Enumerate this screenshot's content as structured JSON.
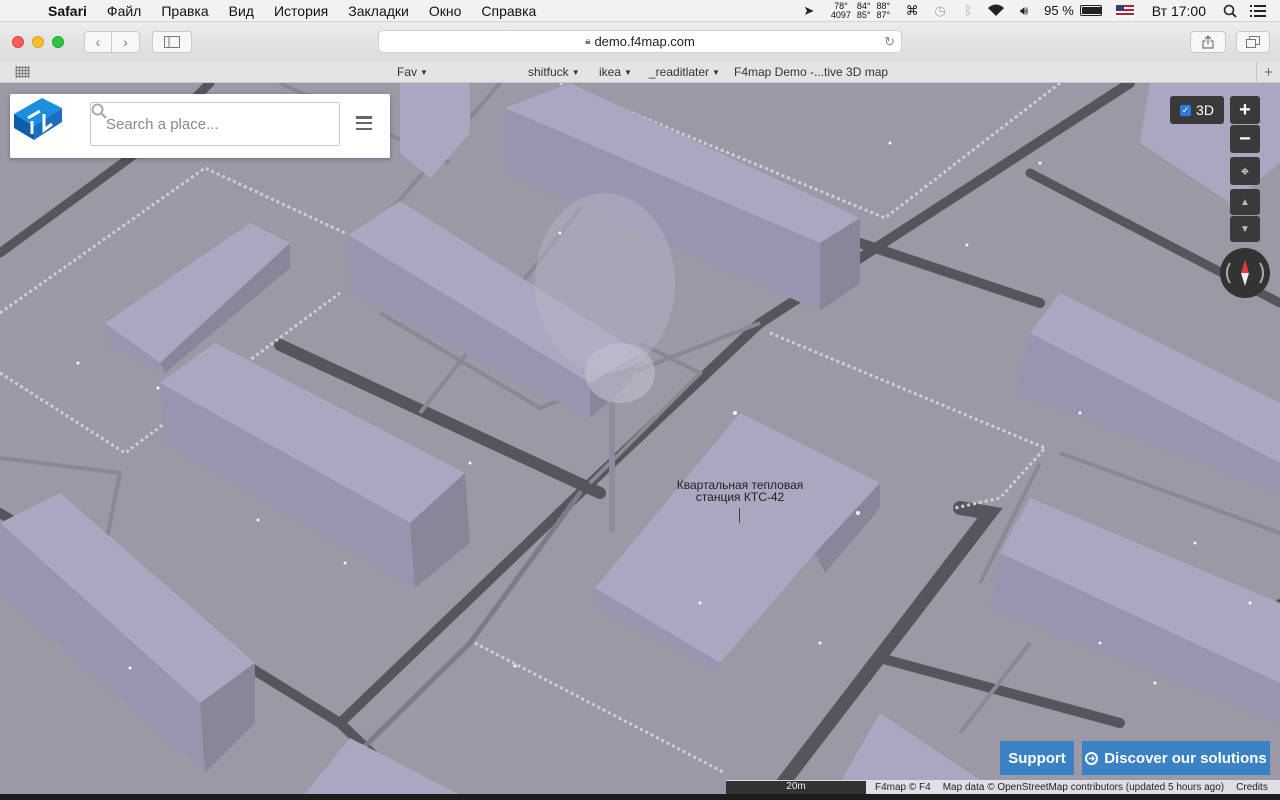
{
  "menubar": {
    "app_name": "Safari",
    "items": [
      "Файл",
      "Правка",
      "Вид",
      "История",
      "Закладки",
      "Окно",
      "Справка"
    ],
    "temps": [
      {
        "top": "78°",
        "bottom": "4097"
      },
      {
        "top": "84°",
        "bottom": "85°"
      },
      {
        "top": "88°",
        "bottom": "87°"
      }
    ],
    "battery": "95 %",
    "clock": "Вт 17:00"
  },
  "toolbar": {
    "url": "demo.f4map.com"
  },
  "bookmarks": {
    "items": [
      {
        "label": "Fav",
        "folder": true
      },
      {
        "label": "shitfuck",
        "folder": true
      },
      {
        "label": "ikea",
        "folder": true
      },
      {
        "label": "_readitlater",
        "folder": true
      },
      {
        "label": "F4map Demo -...tive 3D map",
        "folder": false
      }
    ]
  },
  "map": {
    "search_placeholder": "Search a place...",
    "toggle_3d_label": "3D",
    "label_line1": "Квартальная тепловая",
    "label_line2": "станция КТС-42",
    "support_label": "Support",
    "discover_label": "Discover our solutions",
    "scale_label": "20m",
    "attribution": {
      "brand": "F4map © F4",
      "data": "Map data © OpenStreetMap contributors (updated 5 hours ago)",
      "credits": "Credits"
    },
    "colors": {
      "ground": "#9b99a5",
      "building_top": "#a9a8c0",
      "road": "#525158",
      "button_blue": "#3b82c4"
    }
  }
}
